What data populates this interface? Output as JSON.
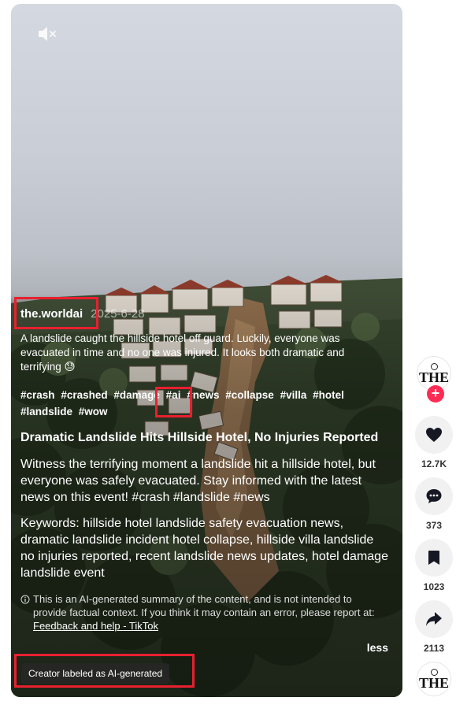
{
  "post": {
    "username": "the.worldai",
    "date": "2025-6-28",
    "description": "A landslide caught the hillside hotel off guard. Luckily, everyone was evacuated in time and no one was injured. It looks both dramatic and terrifying 😓",
    "hashtags": [
      "#crash",
      "#crashed",
      "#damage",
      "#ai",
      "#news",
      "#collapse",
      "#villa",
      "#hotel",
      "#landslide",
      "#wow"
    ],
    "ai_summary": {
      "headline": "Dramatic Landslide Hits Hillside Hotel, No Injuries Reported",
      "summary": "Witness the terrifying moment a landslide hit a hillside hotel, but everyone was safely evacuated. Stay informed with the latest news on this event! #crash #landslide #news",
      "keywords": "Keywords: hillside hotel landslide safety evacuation news, dramatic landslide incident hotel collapse, hillside villa landslide no injuries reported, recent landslide news updates, hotel damage landslide event",
      "disclaimer": "This is an AI-generated summary of the content, and is not intended to provide factual context. If you think it may contain an error, please report at:",
      "feedback_link": "Feedback and help - TikTok"
    },
    "less_label": "less",
    "ai_label": "Creator labeled as AI-generated"
  },
  "actions": {
    "avatar_text": "THE",
    "likes": "12.7K",
    "comments": "373",
    "saves": "1023",
    "shares": "2113"
  },
  "colors": {
    "accent": "#fe2c55",
    "highlight": "#e8202f"
  },
  "icons": [
    "volume-muted-icon",
    "heart-icon",
    "comment-icon",
    "bookmark-icon",
    "share-icon",
    "info-icon",
    "plus-icon"
  ]
}
